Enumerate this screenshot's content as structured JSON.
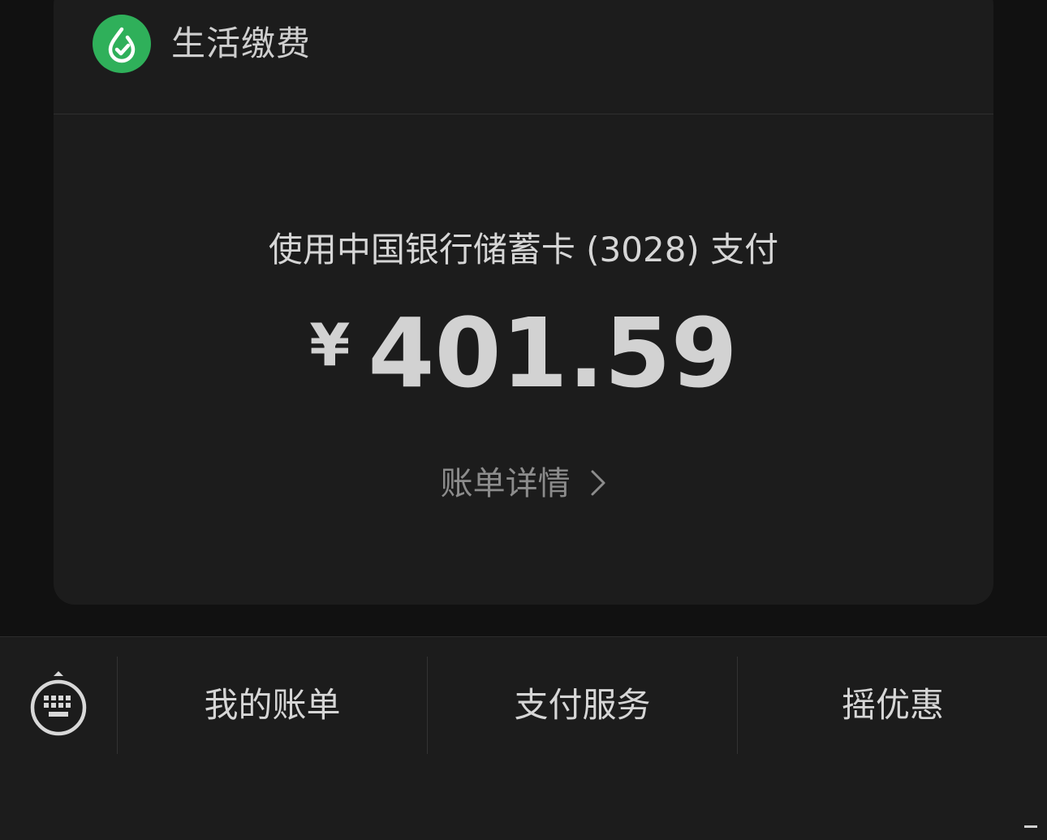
{
  "header": {
    "brand_icon": "utility-payment-icon",
    "brand_color": "#2fb05a",
    "title": "生活缴费"
  },
  "payment": {
    "method_text": "使用中国银行储蓄卡 (3028) 支付",
    "currency_symbol": "¥",
    "amount": "401.59",
    "detail_link": "账单详情",
    "detail_icon": "chevron-right-icon"
  },
  "bottom_menu": {
    "keyboard_icon": "keyboard-icon",
    "items": [
      {
        "label": "我的账单"
      },
      {
        "label": "支付服务"
      },
      {
        "label": "摇优惠"
      }
    ]
  }
}
